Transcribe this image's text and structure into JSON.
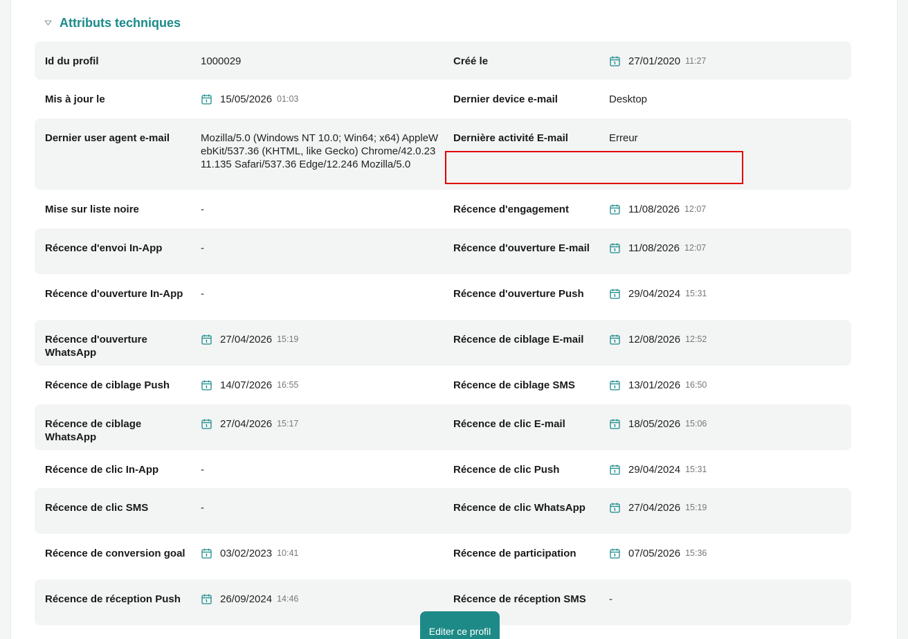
{
  "section": {
    "title": "Attributs techniques"
  },
  "rows": [
    {
      "h": 55,
      "striped": true,
      "l1": "Id du profil",
      "v1": {
        "text": "1000029"
      },
      "l2": "Créé le",
      "v2": {
        "date": "27/01/2020",
        "time": "11:27"
      }
    },
    {
      "h": 56,
      "striped": false,
      "l1": "Mis à jour le",
      "v1": {
        "date": "15/05/2026",
        "time": "01:03"
      },
      "l2": "Dernier device e-mail",
      "v2": {
        "text": "Desktop"
      }
    },
    {
      "h": 103,
      "striped": true,
      "l1": "Dernier user agent e-mail",
      "v1": {
        "text": "Mozilla/5.0 (Windows NT 10.0; Win64; x64) AppleWebKit/537.36 (KHTML, like Gecko) Chrome/42.0.2311.135 Safari/537.36 Edge/12.246 Mozilla/5.0",
        "wrap": true
      },
      "l2": "Dernière activité E-mail",
      "v2": {
        "text": "Erreur"
      }
    },
    {
      "h": 56,
      "striped": false,
      "l1": "Mise sur liste noire",
      "v1": {
        "text": "-"
      },
      "l2": "Récence d'engagement",
      "v2": {
        "date": "11/08/2026",
        "time": "12:07"
      }
    },
    {
      "h": 66,
      "striped": true,
      "l1": "Récence d'envoi In-App",
      "v1": {
        "text": "-"
      },
      "l2": "Récence d'ouverture E-mail",
      "v2": {
        "date": "11/08/2026",
        "time": "12:07"
      }
    },
    {
      "h": 66,
      "striped": false,
      "l1": "Récence d'ouverture In-App",
      "v1": {
        "text": "-"
      },
      "l2": "Récence d'ouverture Push",
      "v2": {
        "date": "29/04/2024",
        "time": "15:31"
      }
    },
    {
      "h": 66,
      "striped": true,
      "l1": "Récence d'ouverture WhatsApp",
      "v1": {
        "date": "27/04/2026",
        "time": "15:19"
      },
      "l2": "Récence de ciblage E-mail",
      "v2": {
        "date": "12/08/2026",
        "time": "12:52"
      }
    },
    {
      "h": 56,
      "striped": false,
      "l1": "Récence de ciblage Push",
      "v1": {
        "date": "14/07/2026",
        "time": "16:55"
      },
      "l2": "Récence de ciblage SMS",
      "v2": {
        "date": "13/01/2026",
        "time": "16:50"
      }
    },
    {
      "h": 66,
      "striped": true,
      "l1": "Récence de ciblage WhatsApp",
      "v1": {
        "date": "27/04/2026",
        "time": "15:17"
      },
      "l2": "Récence de clic E-mail",
      "v2": {
        "date": "18/05/2026",
        "time": "15:06"
      }
    },
    {
      "h": 55,
      "striped": false,
      "l1": "Récence de clic In-App",
      "v1": {
        "text": "-"
      },
      "l2": "Récence de clic Push",
      "v2": {
        "date": "29/04/2024",
        "time": "15:31"
      }
    },
    {
      "h": 66,
      "striped": true,
      "l1": "Récence de clic SMS",
      "v1": {
        "text": "-"
      },
      "l2": "Récence de clic WhatsApp",
      "v2": {
        "date": "27/04/2026",
        "time": "15:19"
      }
    },
    {
      "h": 66,
      "striped": false,
      "l1": "Récence de conversion goal",
      "v1": {
        "date": "03/02/2023",
        "time": "10:41"
      },
      "l2": "Récence de participation",
      "v2": {
        "date": "07/05/2026",
        "time": "15:36"
      }
    },
    {
      "h": 66,
      "striped": true,
      "l1": "Récence de réception Push",
      "v1": {
        "date": "26/09/2024",
        "time": "14:46"
      },
      "l2": "Récence de réception SMS",
      "v2": {
        "text": "-"
      }
    }
  ],
  "highlight": {
    "row": 3,
    "col": 2
  },
  "actions": {
    "edit_label": "Editer ce profil"
  },
  "colors": {
    "accent": "#1b8a8a",
    "button": "#1d8a87",
    "highlight": "#e00000"
  },
  "icons": {
    "chevron": "chevron-down-icon",
    "date": "calendar-icon"
  }
}
